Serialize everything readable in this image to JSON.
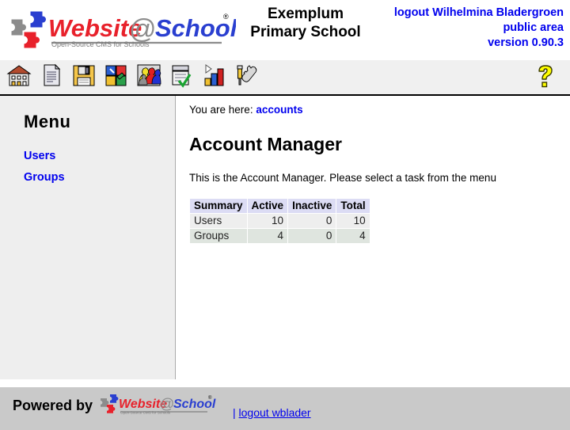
{
  "header": {
    "logo": {
      "brand_part1": "Website",
      "brand_at": "@",
      "brand_part2": "School",
      "registered_mark": "®",
      "tagline": "Open-Source CMS for Schools"
    },
    "school_name_line1": "Exemplum",
    "school_name_line2": "Primary School",
    "logout_line": "logout Wilhelmina Bladergroen",
    "area_line": "public area",
    "version_line": "version 0.90.3"
  },
  "toolbar": {
    "icons": [
      {
        "name": "school-home-icon",
        "title": "School / Home"
      },
      {
        "name": "page-manager-icon",
        "title": "Page Manager"
      },
      {
        "name": "file-manager-icon",
        "title": "File Manager"
      },
      {
        "name": "module-manager-icon",
        "title": "Module Manager"
      },
      {
        "name": "account-manager-icon",
        "title": "Account Manager"
      },
      {
        "name": "tasks-checklist-icon",
        "title": "Tasks"
      },
      {
        "name": "statistics-icon",
        "title": "Statistics"
      },
      {
        "name": "tools-icon",
        "title": "Tools"
      }
    ],
    "help": {
      "name": "help-icon",
      "title": "Help",
      "glyph": "?"
    }
  },
  "sidebar": {
    "title": "Menu",
    "items": [
      {
        "label": "Users"
      },
      {
        "label": "Groups"
      }
    ]
  },
  "content": {
    "breadcrumb_prefix": "You are here:",
    "breadcrumb_current": "accounts",
    "page_title": "Account Manager",
    "intro": "This is the Account Manager. Please select a task from the menu"
  },
  "summary_table": {
    "columns": [
      "Summary",
      "Active",
      "Inactive",
      "Total"
    ],
    "rows": [
      {
        "label": "Users",
        "active": "10",
        "inactive": "0",
        "total": "10"
      },
      {
        "label": "Groups",
        "active": "4",
        "inactive": "0",
        "total": "4"
      }
    ]
  },
  "footer": {
    "powered_by": "Powered by",
    "logo": {
      "brand_part1": "Website",
      "brand_at": "@",
      "brand_part2": "School",
      "registered_mark": "®",
      "tagline": "Open-Source CMS for Schools"
    },
    "separator": "|",
    "logout_label": "logout wblader"
  },
  "colors": {
    "link_blue": "#0000ee",
    "logo_red": "#e8212b",
    "logo_blue": "#2222cc",
    "logo_gray": "#888888",
    "table_header_bg": "#dcdcf4",
    "row_odd_bg": "#eeeeee",
    "row_even_bg": "#dfe5df",
    "sidebar_bg": "#eeeeee",
    "toolbar_bg": "#f0f0f0",
    "footer_bg": "#c9c9c9",
    "help_yellow": "#ffff00"
  }
}
